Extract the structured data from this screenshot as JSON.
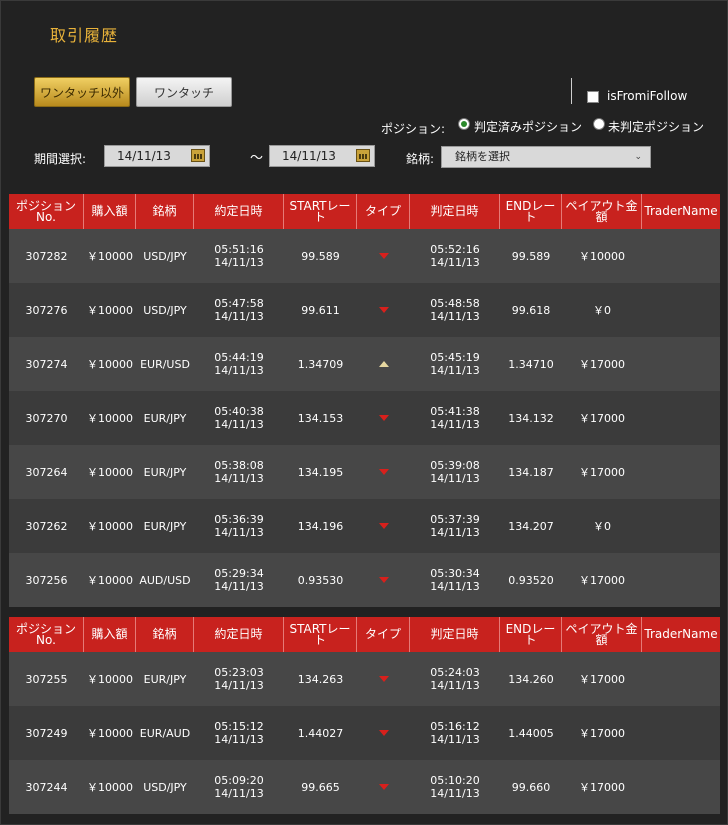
{
  "page": {
    "title": "取引履歴"
  },
  "tabs": [
    {
      "label": "ワンタッチ以外",
      "active": true
    },
    {
      "label": "ワンタッチ",
      "active": false
    }
  ],
  "filter": {
    "is_from_i_follow_label": "isFromiFollow",
    "position_label": "ポジション:",
    "radio_settled": "判定済みポジション",
    "radio_unsettled": "未判定ポジション",
    "period_label": "期間選択:",
    "date_from": "14/11/13",
    "tilde": "～",
    "date_to": "14/11/13",
    "symbol_label": "銘柄:",
    "symbol_select": "銘柄を選択",
    "select_arrow": "⌄"
  },
  "columns": [
    "ポジション\nNo.",
    "購入額",
    "銘柄",
    "約定日時",
    "STARTレー\nト",
    "タイプ",
    "判定日時",
    "ENDレー\nト",
    "ペイアウト金\n額",
    "TraderName"
  ],
  "tables": [
    {
      "rows": [
        {
          "no": "307282",
          "amount": "￥10000",
          "symbol": "USD/JPY",
          "exec_time": "05:51:16",
          "exec_date": "14/11/13",
          "start": "99.589",
          "type": "down",
          "judge_time": "05:52:16",
          "judge_date": "14/11/13",
          "end": "99.589",
          "payout": "￥10000",
          "trader": ""
        },
        {
          "no": "307276",
          "amount": "￥10000",
          "symbol": "USD/JPY",
          "exec_time": "05:47:58",
          "exec_date": "14/11/13",
          "start": "99.611",
          "type": "down",
          "judge_time": "05:48:58",
          "judge_date": "14/11/13",
          "end": "99.618",
          "payout": "￥0",
          "trader": ""
        },
        {
          "no": "307274",
          "amount": "￥10000",
          "symbol": "EUR/USD",
          "exec_time": "05:44:19",
          "exec_date": "14/11/13",
          "start": "1.34709",
          "type": "up",
          "judge_time": "05:45:19",
          "judge_date": "14/11/13",
          "end": "1.34710",
          "payout": "￥17000",
          "trader": ""
        },
        {
          "no": "307270",
          "amount": "￥10000",
          "symbol": "EUR/JPY",
          "exec_time": "05:40:38",
          "exec_date": "14/11/13",
          "start": "134.153",
          "type": "down",
          "judge_time": "05:41:38",
          "judge_date": "14/11/13",
          "end": "134.132",
          "payout": "￥17000",
          "trader": ""
        },
        {
          "no": "307264",
          "amount": "￥10000",
          "symbol": "EUR/JPY",
          "exec_time": "05:38:08",
          "exec_date": "14/11/13",
          "start": "134.195",
          "type": "down",
          "judge_time": "05:39:08",
          "judge_date": "14/11/13",
          "end": "134.187",
          "payout": "￥17000",
          "trader": ""
        },
        {
          "no": "307262",
          "amount": "￥10000",
          "symbol": "EUR/JPY",
          "exec_time": "05:36:39",
          "exec_date": "14/11/13",
          "start": "134.196",
          "type": "down",
          "judge_time": "05:37:39",
          "judge_date": "14/11/13",
          "end": "134.207",
          "payout": "￥0",
          "trader": ""
        },
        {
          "no": "307256",
          "amount": "￥10000",
          "symbol": "AUD/USD",
          "exec_time": "05:29:34",
          "exec_date": "14/11/13",
          "start": "0.93530",
          "type": "down",
          "judge_time": "05:30:34",
          "judge_date": "14/11/13",
          "end": "0.93520",
          "payout": "￥17000",
          "trader": ""
        }
      ]
    },
    {
      "rows": [
        {
          "no": "307255",
          "amount": "￥10000",
          "symbol": "EUR/JPY",
          "exec_time": "05:23:03",
          "exec_date": "14/11/13",
          "start": "134.263",
          "type": "down",
          "judge_time": "05:24:03",
          "judge_date": "14/11/13",
          "end": "134.260",
          "payout": "￥17000",
          "trader": ""
        },
        {
          "no": "307249",
          "amount": "￥10000",
          "symbol": "EUR/AUD",
          "exec_time": "05:15:12",
          "exec_date": "14/11/13",
          "start": "1.44027",
          "type": "down",
          "judge_time": "05:16:12",
          "judge_date": "14/11/13",
          "end": "1.44005",
          "payout": "￥17000",
          "trader": ""
        },
        {
          "no": "307244",
          "amount": "￥10000",
          "symbol": "USD/JPY",
          "exec_time": "05:09:20",
          "exec_date": "14/11/13",
          "start": "99.665",
          "type": "down",
          "judge_time": "05:10:20",
          "judge_date": "14/11/13",
          "end": "99.660",
          "payout": "￥17000",
          "trader": ""
        }
      ]
    }
  ],
  "colors": {
    "header_red": "#c8221e",
    "accent_gold": "#e8b23a",
    "down_arrow": "#d8201c",
    "up_arrow": "#e6d7a0"
  }
}
